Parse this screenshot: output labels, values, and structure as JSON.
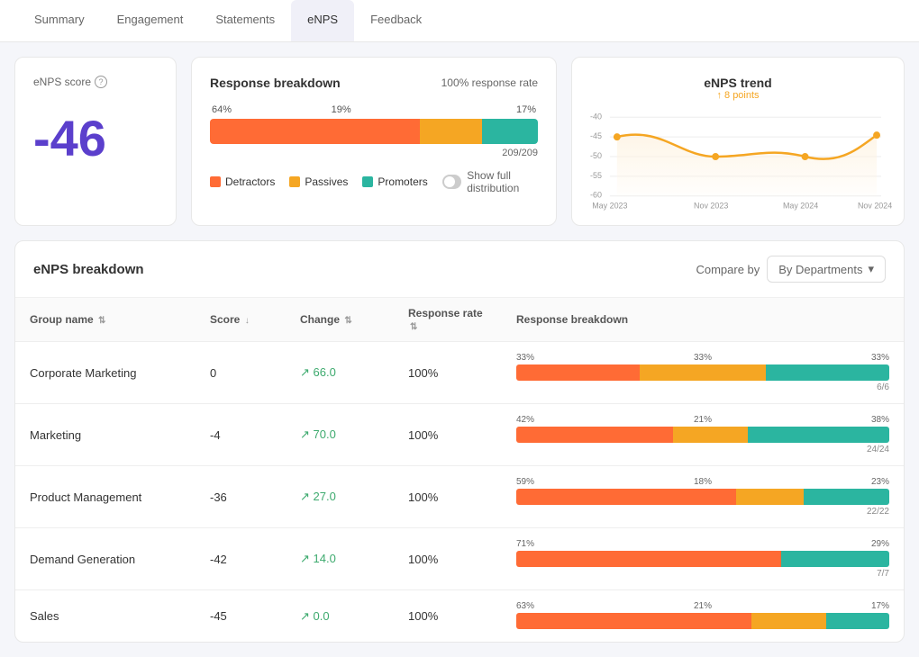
{
  "nav": {
    "tabs": [
      {
        "id": "summary",
        "label": "Summary",
        "active": false
      },
      {
        "id": "engagement",
        "label": "Engagement",
        "active": false
      },
      {
        "id": "statements",
        "label": "Statements",
        "active": false
      },
      {
        "id": "enps",
        "label": "eNPS",
        "active": true
      },
      {
        "id": "feedback",
        "label": "Feedback",
        "active": false
      }
    ]
  },
  "enps_score_card": {
    "label": "eNPS score",
    "value": "-46"
  },
  "response_breakdown": {
    "title": "Response breakdown",
    "response_rate": "100% response rate",
    "pct_red": "64%",
    "pct_yellow": "19%",
    "pct_teal": "17%",
    "count": "209/209",
    "legend": {
      "detractors": "Detractors",
      "passives": "Passives",
      "promoters": "Promoters"
    },
    "toggle_label": "Show full distribution"
  },
  "trend": {
    "title": "eNPS trend",
    "points": "8 points",
    "x_labels": [
      "May 2023",
      "Nov 2023",
      "May 2024",
      "Nov 2024"
    ],
    "y_labels": [
      "-40",
      "-45",
      "-50",
      "-55",
      "-60"
    ]
  },
  "breakdown_section": {
    "title": "eNPS breakdown",
    "compare_label": "Compare by",
    "dropdown_label": "By Departments",
    "table": {
      "headers": [
        {
          "label": "Group name",
          "sortable": true
        },
        {
          "label": "Score",
          "sortable": true
        },
        {
          "label": "Change",
          "sortable": true
        },
        {
          "label": "Response rate",
          "sortable": true
        },
        {
          "label": "Response breakdown",
          "sortable": false
        }
      ],
      "rows": [
        {
          "group": "Corporate Marketing",
          "score": "0",
          "change": "66.0",
          "response_rate": "100%",
          "bar_red": 33,
          "bar_yellow": 34,
          "bar_teal": 33,
          "pct_red": "33%",
          "pct_yellow": "33%",
          "pct_teal": "33%",
          "count": "6/6"
        },
        {
          "group": "Marketing",
          "score": "-4",
          "change": "70.0",
          "response_rate": "100%",
          "bar_red": 42,
          "bar_yellow": 20,
          "bar_teal": 38,
          "pct_red": "42%",
          "pct_yellow": "21%",
          "pct_teal": "38%",
          "count": "24/24"
        },
        {
          "group": "Product Management",
          "score": "-36",
          "change": "27.0",
          "response_rate": "100%",
          "bar_red": 59,
          "bar_yellow": 18,
          "bar_teal": 23,
          "pct_red": "59%",
          "pct_yellow": "18%",
          "pct_teal": "23%",
          "count": "22/22"
        },
        {
          "group": "Demand Generation",
          "score": "-42",
          "change": "14.0",
          "response_rate": "100%",
          "bar_red": 71,
          "bar_yellow": 0,
          "bar_teal": 29,
          "pct_red": "71%",
          "pct_yellow": "",
          "pct_teal": "29%",
          "count": "7/7"
        },
        {
          "group": "Sales",
          "score": "-45",
          "change": "0.0",
          "response_rate": "100%",
          "bar_red": 63,
          "bar_yellow": 20,
          "bar_teal": 17,
          "pct_red": "63%",
          "pct_yellow": "21%",
          "pct_teal": "17%",
          "count": ""
        }
      ]
    }
  }
}
